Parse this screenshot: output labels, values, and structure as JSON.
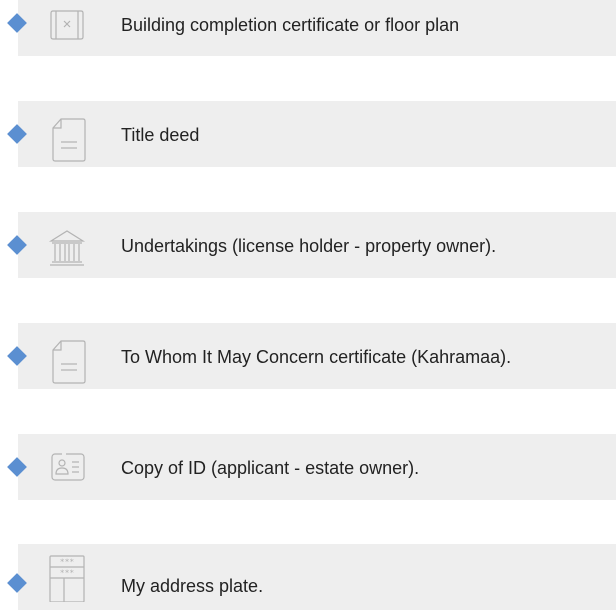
{
  "accent_color": "#5b8fd1",
  "card_background": "#eeeeee",
  "documents": [
    {
      "label": "Building completion certificate or floor plan",
      "icon": "floor-plan-icon"
    },
    {
      "label": "Title deed",
      "icon": "document-icon"
    },
    {
      "label": "Undertakings (license holder - property owner).",
      "icon": "bank-building-icon"
    },
    {
      "label": "To Whom It May Concern certificate (Kahramaa).",
      "icon": "document-icon"
    },
    {
      "label": "Copy of ID (applicant - estate owner).",
      "icon": "id-card-icon"
    },
    {
      "label": "My address plate.",
      "icon": "address-plate-icon"
    }
  ]
}
